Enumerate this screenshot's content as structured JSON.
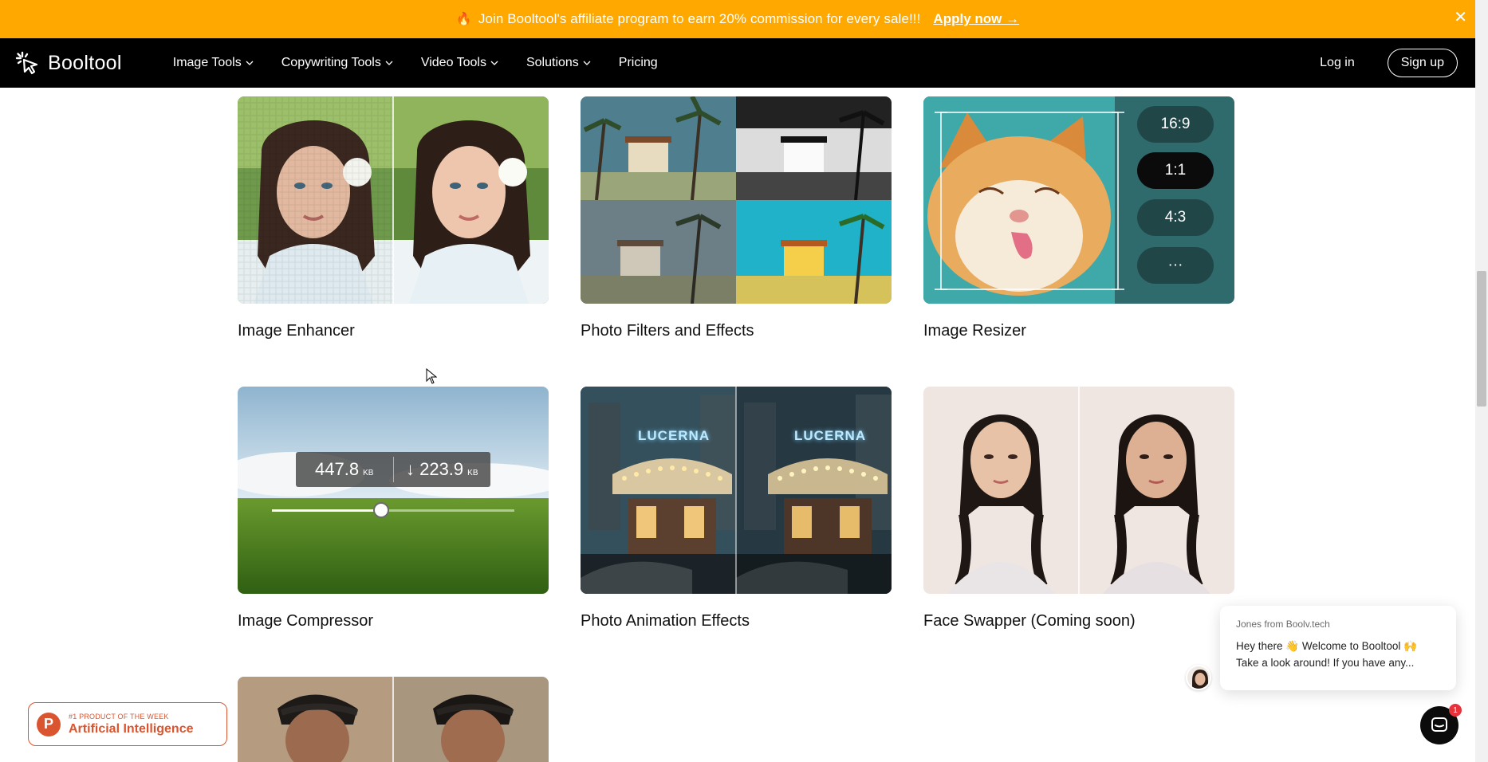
{
  "promo": {
    "fire": "🔥",
    "message": "Join Booltool's affiliate program to earn 20% commission for every sale!!!",
    "cta": "Apply now →",
    "close": "✕"
  },
  "nav": {
    "brand": "Booltool",
    "menu": [
      {
        "label": "Image Tools"
      },
      {
        "label": "Copywriting Tools"
      },
      {
        "label": "Video Tools"
      },
      {
        "label": "Solutions"
      },
      {
        "label": "Pricing"
      }
    ],
    "login": "Log in",
    "signup": "Sign up"
  },
  "tools": [
    {
      "title": "Image Enhancer"
    },
    {
      "title": "Photo Filters and Effects"
    },
    {
      "title": "Image Resizer"
    },
    {
      "title": "Image Compressor"
    },
    {
      "title": "Photo Animation Effects"
    },
    {
      "title": "Face Swapper (Coming soon)"
    }
  ],
  "resizer": {
    "ratios": [
      "16:9",
      "1:1",
      "4:3",
      "···"
    ],
    "active_index": 1
  },
  "compressor": {
    "original_size": "447.8",
    "compressed_size": "↓ 223.9",
    "unit": "KB",
    "slider_fraction": 0.45
  },
  "animation": {
    "sign_text": "LUCERNA"
  },
  "badge": {
    "small": "#1 PRODUCT OF THE WEEK",
    "big": "Artificial Intelligence",
    "letter": "P"
  },
  "chat": {
    "from": "Jones from Boolv.tech",
    "line1": "Hey there 👋 Welcome to Booltool 🙌",
    "line2": "Take a look around! If you have any...",
    "unread": "1"
  },
  "colors": {
    "banner": "#ffa800",
    "nav_bg": "#000000",
    "ph_orange": "#da552f",
    "chat_badge": "#e8323b"
  }
}
